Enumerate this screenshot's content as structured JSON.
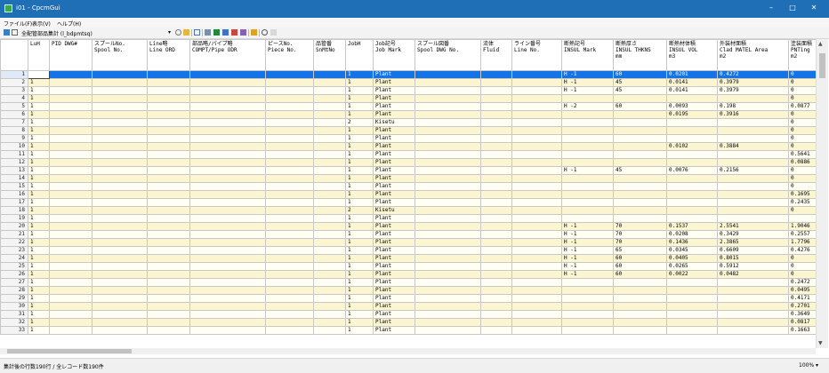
{
  "window": {
    "title": "i01 - CpcmGui",
    "minimize_glyph": "–",
    "maximize_glyph": "□",
    "close_glyph": "✕",
    "accent": "#1f6fb7"
  },
  "menu": {
    "items": [
      "ファイル(F)",
      "表示(V)",
      "ヘルプ(H)"
    ]
  },
  "toolbar": {
    "label": "全配管部品集計 (l_bdpmtsq)",
    "icons": [
      "dropdown-icon",
      "search-icon",
      "folder-icon",
      "table-icon",
      "export-icon",
      "excel-icon",
      "pdf-icon",
      "copy-icon",
      "paste-icon",
      "chart-icon",
      "find-icon",
      "clear-icon"
    ]
  },
  "grid": {
    "columns": [
      "LuH",
      "PID DWG#",
      "スプールNo.\nSpool No.",
      "Line略\nLine ORD",
      "部品略/パイプ略\nCOMPT/Pipe ODR",
      "ピースNo.\nPiece No.",
      "品管番\nSnMtNo",
      "JobH",
      "Job記号\nJob Mark",
      "スプール図番\nSpool DWG No.",
      "流体\nFluid",
      "ライン番号\nLine No.",
      "断熱記号\nINSUL Mark",
      "断熱厚さ\nINSUL THKNS\nmm",
      "断熱材体積\nINSUL VOL\nm3",
      "外装材面積\nClad MATEL Area\nm2",
      "塗装面積\nPNTing\nm2"
    ],
    "rows": [
      [
        "1",
        "",
        "",
        "",
        "",
        "",
        "",
        "",
        "1",
        "Plant",
        "",
        "",
        "",
        "H -1",
        "60",
        "0.0201",
        "0.4272",
        "0"
      ],
      [
        "2",
        "1",
        "",
        "",
        "",
        "",
        "",
        "",
        "1",
        "Plant",
        "",
        "",
        "",
        "H -1",
        "45",
        "0.0141",
        "0.3979",
        "0"
      ],
      [
        "3",
        "1",
        "",
        "",
        "",
        "",
        "",
        "",
        "1",
        "Plant",
        "",
        "",
        "",
        "H -1",
        "45",
        "0.0141",
        "0.3979",
        "0"
      ],
      [
        "4",
        "1",
        "",
        "",
        "",
        "",
        "",
        "",
        "1",
        "Plant",
        "",
        "",
        "",
        "",
        "",
        "",
        "",
        "0"
      ],
      [
        "5",
        "1",
        "",
        "",
        "",
        "",
        "",
        "",
        "1",
        "Plant",
        "",
        "",
        "",
        "H -2",
        "60",
        "0.0093",
        "0.198",
        "0.0877"
      ],
      [
        "6",
        "1",
        "",
        "",
        "",
        "",
        "",
        "",
        "1",
        "Plant",
        "",
        "",
        "",
        "",
        "",
        "0.0195",
        "0.3916",
        "0"
      ],
      [
        "7",
        "1",
        "",
        "",
        "",
        "",
        "",
        "",
        "2",
        "Kisetu",
        "",
        "",
        "",
        "",
        "",
        "",
        "",
        "0"
      ],
      [
        "8",
        "1",
        "",
        "",
        "",
        "",
        "",
        "",
        "1",
        "Plant",
        "",
        "",
        "",
        "",
        "",
        "",
        "",
        "0"
      ],
      [
        "9",
        "1",
        "",
        "",
        "",
        "",
        "",
        "",
        "1",
        "Plant",
        "",
        "",
        "",
        "",
        "",
        "",
        "",
        "0"
      ],
      [
        "10",
        "1",
        "",
        "",
        "",
        "",
        "",
        "",
        "1",
        "Plant",
        "",
        "",
        "",
        "",
        "",
        "0.0102",
        "0.3884",
        "0"
      ],
      [
        "11",
        "1",
        "",
        "",
        "",
        "",
        "",
        "",
        "1",
        "Plant",
        "",
        "",
        "",
        "",
        "",
        "",
        "",
        "0.5641"
      ],
      [
        "12",
        "1",
        "",
        "",
        "",
        "",
        "",
        "",
        "1",
        "Plant",
        "",
        "",
        "",
        "",
        "",
        "",
        "",
        "0.0886"
      ],
      [
        "13",
        "1",
        "",
        "",
        "",
        "",
        "",
        "",
        "1",
        "Plant",
        "",
        "",
        "",
        "H -1",
        "45",
        "0.0076",
        "0.2156",
        "0"
      ],
      [
        "14",
        "1",
        "",
        "",
        "",
        "",
        "",
        "",
        "1",
        "Plant",
        "",
        "",
        "",
        "",
        "",
        "",
        "",
        "0"
      ],
      [
        "15",
        "1",
        "",
        "",
        "",
        "",
        "",
        "",
        "1",
        "Plant",
        "",
        "",
        "",
        "",
        "",
        "",
        "",
        "0"
      ],
      [
        "16",
        "1",
        "",
        "",
        "",
        "",
        "",
        "",
        "1",
        "Plant",
        "",
        "",
        "",
        "",
        "",
        "",
        "",
        "0.1695"
      ],
      [
        "17",
        "1",
        "",
        "",
        "",
        "",
        "",
        "",
        "1",
        "Plant",
        "",
        "",
        "",
        "",
        "",
        "",
        "",
        "0.2435"
      ],
      [
        "18",
        "1",
        "",
        "",
        "",
        "",
        "",
        "",
        "2",
        "Kisetu",
        "",
        "",
        "",
        "",
        "",
        "",
        "",
        "0"
      ],
      [
        "19",
        "1",
        "",
        "",
        "",
        "",
        "",
        "",
        "1",
        "Plant",
        "",
        "",
        "",
        "",
        "",
        "",
        "",
        ""
      ],
      [
        "20",
        "1",
        "",
        "",
        "",
        "",
        "",
        "",
        "1",
        "Plant",
        "",
        "",
        "",
        "H -1",
        "70",
        "0.1537",
        "2.5541",
        "1.9046"
      ],
      [
        "21",
        "1",
        "",
        "",
        "",
        "",
        "",
        "",
        "1",
        "Plant",
        "",
        "",
        "",
        "H -1",
        "70",
        "0.0208",
        "0.3429",
        "0.2557"
      ],
      [
        "22",
        "1",
        "",
        "",
        "",
        "",
        "",
        "",
        "1",
        "Plant",
        "",
        "",
        "",
        "H -1",
        "70",
        "0.1436",
        "2.3865",
        "1.7796"
      ],
      [
        "23",
        "1",
        "",
        "",
        "",
        "",
        "",
        "",
        "1",
        "Plant",
        "",
        "",
        "",
        "H -1",
        "65",
        "0.0345",
        "0.6609",
        "0.4276"
      ],
      [
        "24",
        "1",
        "",
        "",
        "",
        "",
        "",
        "",
        "1",
        "Plant",
        "",
        "",
        "",
        "H -1",
        "60",
        "0.0405",
        "0.8015",
        "0"
      ],
      [
        "25",
        "1",
        "",
        "",
        "",
        "",
        "",
        "",
        "1",
        "Plant",
        "",
        "",
        "",
        "H -1",
        "60",
        "0.0265",
        "0.5912",
        "0"
      ],
      [
        "26",
        "1",
        "",
        "",
        "",
        "",
        "",
        "",
        "1",
        "Plant",
        "",
        "",
        "",
        "H -1",
        "60",
        "0.0022",
        "0.0482",
        "0"
      ],
      [
        "27",
        "1",
        "",
        "",
        "",
        "",
        "",
        "",
        "1",
        "Plant",
        "",
        "",
        "",
        "",
        "",
        "",
        "",
        "0.2472"
      ],
      [
        "28",
        "1",
        "",
        "",
        "",
        "",
        "",
        "",
        "1",
        "Plant",
        "",
        "",
        "",
        "",
        "",
        "",
        "",
        "0.0495"
      ],
      [
        "29",
        "1",
        "",
        "",
        "",
        "",
        "",
        "",
        "1",
        "Plant",
        "",
        "",
        "",
        "",
        "",
        "",
        "",
        "0.4171"
      ],
      [
        "30",
        "1",
        "",
        "",
        "",
        "",
        "",
        "",
        "1",
        "Plant",
        "",
        "",
        "",
        "",
        "",
        "",
        "",
        "0.2701"
      ],
      [
        "31",
        "1",
        "",
        "",
        "",
        "",
        "",
        "",
        "1",
        "Plant",
        "",
        "",
        "",
        "",
        "",
        "",
        "",
        "0.3649"
      ],
      [
        "32",
        "1",
        "",
        "",
        "",
        "",
        "",
        "",
        "1",
        "Plant",
        "",
        "",
        "",
        "",
        "",
        "",
        "",
        "0.0817"
      ],
      [
        "33",
        "1",
        "",
        "",
        "",
        "",
        "",
        "",
        "1",
        "Plant",
        "",
        "",
        "",
        "",
        "",
        "",
        "",
        "0.1663"
      ]
    ]
  },
  "status": {
    "text": "集計後の行数190行 / 全レコード数190件",
    "zoom": "100% ▾"
  }
}
